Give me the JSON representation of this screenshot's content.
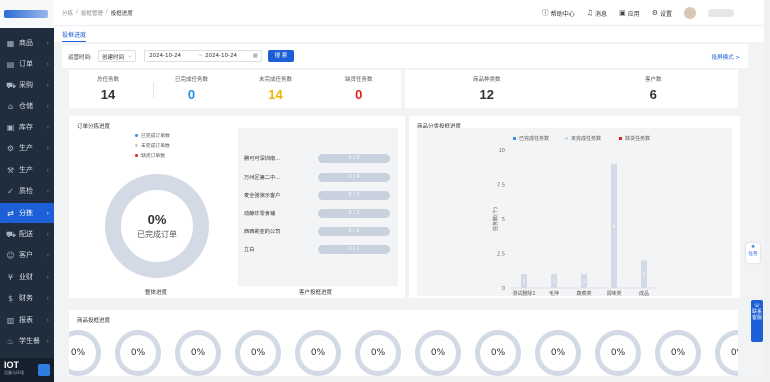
{
  "sidebar": {
    "items": [
      {
        "label": "商品",
        "icon": "grid-icon",
        "glyph": "▦"
      },
      {
        "label": "订单",
        "icon": "order-icon",
        "glyph": "▤"
      },
      {
        "label": "采购",
        "icon": "cart-icon",
        "glyph": "⛟"
      },
      {
        "label": "仓储",
        "icon": "warehouse-icon",
        "glyph": "⌂"
      },
      {
        "label": "库存",
        "icon": "stock-icon",
        "glyph": "▣"
      },
      {
        "label": "生产",
        "icon": "production-icon",
        "glyph": "⚙"
      },
      {
        "label": "生产",
        "icon": "production-icon",
        "glyph": "⚒"
      },
      {
        "label": "质检",
        "icon": "quality-icon",
        "glyph": "✓"
      },
      {
        "label": "分拣",
        "icon": "sort-icon",
        "glyph": "⇄"
      },
      {
        "label": "配送",
        "icon": "delivery-icon",
        "glyph": "⛟"
      },
      {
        "label": "客户",
        "icon": "customer-icon",
        "glyph": "☺"
      },
      {
        "label": "业财",
        "icon": "finance-icon",
        "glyph": "¥"
      },
      {
        "label": "财务",
        "icon": "money-icon",
        "glyph": "$"
      },
      {
        "label": "报表",
        "icon": "report-icon",
        "glyph": "▥"
      },
      {
        "label": "学生餐",
        "icon": "meal-icon",
        "glyph": "♨"
      }
    ],
    "active_index": 8,
    "bottom_brand": "IOT",
    "bottom_sub": "设备与环境"
  },
  "breadcrumb": [
    "分拣",
    "投框管理",
    "投框进度"
  ],
  "topbar": {
    "help": "帮助中心",
    "messages": "消息",
    "apps": "应用",
    "settings": "设置"
  },
  "tab": "投框进度",
  "filter": {
    "label": "运营时间:",
    "select_value": "创建时间",
    "date_start": "2024-10-24",
    "date_sep": "~",
    "date_end": "2024-10-24",
    "search_label": "搜 索",
    "mode_link": "投屏模式 >"
  },
  "stats_left": [
    {
      "title": "总任务数",
      "value": "14",
      "color": "#333333"
    },
    {
      "title": "已完成任务数",
      "value": "0",
      "color": "#1d8fe0"
    },
    {
      "title": "未完成任务数",
      "value": "14",
      "color": "#f0b400"
    },
    {
      "title": "缺货任务数",
      "value": "0",
      "color": "#e02020"
    }
  ],
  "stats_right": [
    {
      "title": "商品种类数",
      "value": "12",
      "color": "#333333"
    },
    {
      "title": "客户数",
      "value": "6",
      "color": "#333333"
    }
  ],
  "order_panel": {
    "title": "订单分拣进度",
    "legend": [
      {
        "label": "已完成订单数",
        "color": "#3a8ee6"
      },
      {
        "label": "未完成订单数",
        "color": "#c9cfd9"
      },
      {
        "label": "缺货订单数",
        "color": "#e02020"
      }
    ],
    "donut_percent": "0%",
    "donut_label": "已完成订单",
    "overall_caption": "整体进度",
    "customer_caption": "客户投框进度",
    "customers": [
      {
        "name": "腾可可深圳南...",
        "progress": "0 / 3"
      },
      {
        "name": "万州区第二中...",
        "progress": "0 / 4"
      },
      {
        "name": "麦全驰演示客户",
        "progress": "0 / 3"
      },
      {
        "name": "动鲸炊零食铺",
        "progress": "0 / 2"
      },
      {
        "name": "西西莉亚的公司",
        "progress": "0 / 1"
      },
      {
        "name": "立白",
        "progress": "0 / 1"
      }
    ]
  },
  "category_panel": {
    "title": "商品分类投框进度"
  },
  "chart_data": {
    "type": "bar",
    "title": "",
    "ylabel": "任务数(个)",
    "xlabel": "",
    "ylim": [
      0,
      10
    ],
    "yticks": [
      0,
      2.5,
      5,
      7.5,
      10
    ],
    "categories": [
      "测试删除1",
      "毛萍",
      "蔬菜类",
      "调味类",
      "成品"
    ],
    "series": [
      {
        "name": "已完成任务数",
        "color": "#3a8ee6",
        "values": [
          0,
          0,
          0,
          0,
          0
        ]
      },
      {
        "name": "未完成任务数",
        "color": "#d3dae6",
        "values": [
          1,
          1,
          1,
          9,
          2
        ]
      },
      {
        "name": "缺货任务数",
        "color": "#e02020",
        "values": [
          0,
          0,
          0,
          0,
          0
        ]
      }
    ],
    "bar_labels": [
      1,
      1,
      1,
      9,
      2
    ],
    "legend_position": "top",
    "grid": false
  },
  "goods_panel": {
    "title": "商品投框进度",
    "circles": [
      "0%",
      "0%",
      "0%",
      "0%",
      "0%",
      "0%",
      "0%",
      "0%",
      "0%",
      "0%",
      "0%",
      "0%"
    ]
  },
  "floaters": {
    "task": "任务",
    "blue": "联系客服"
  }
}
